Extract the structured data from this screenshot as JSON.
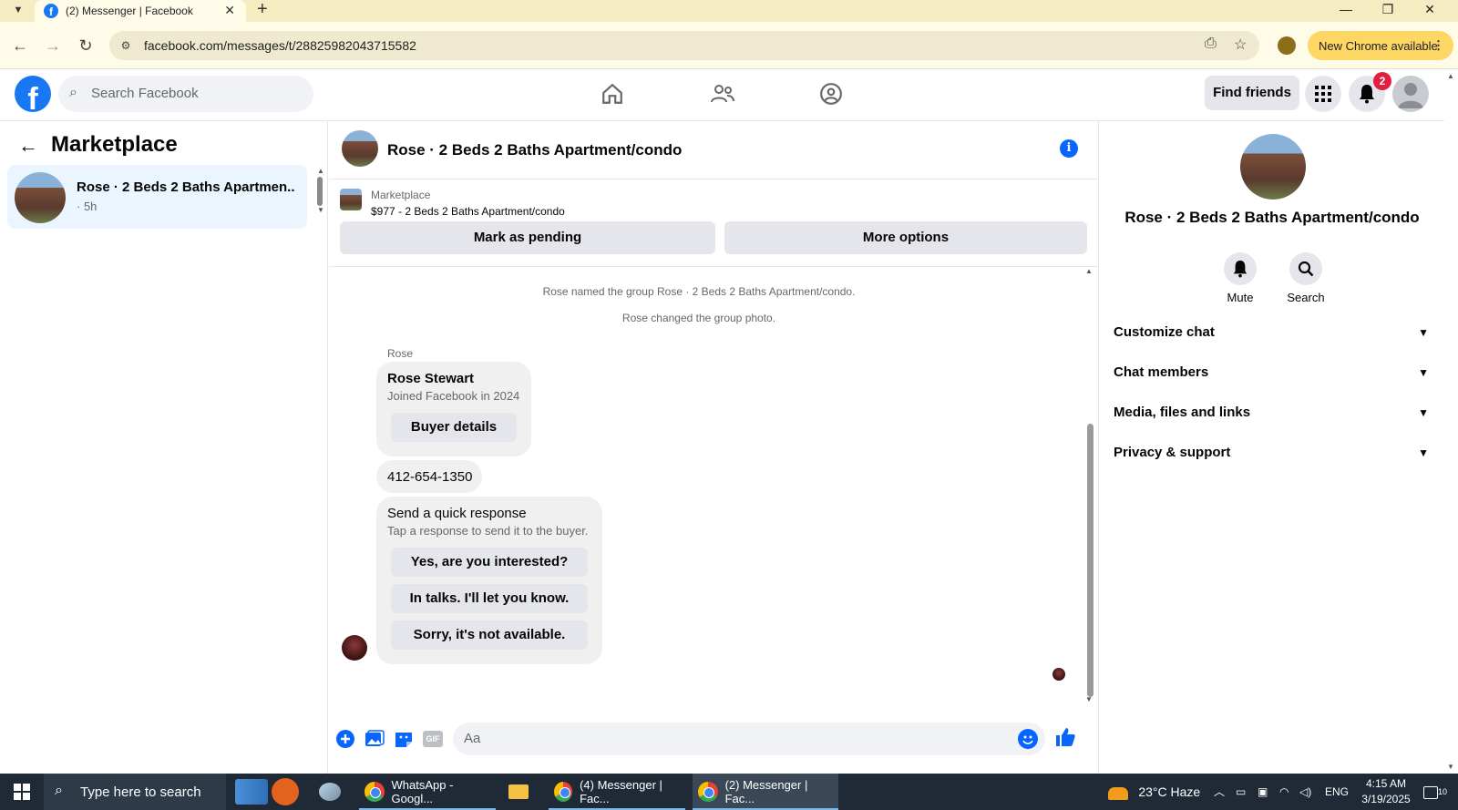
{
  "browser": {
    "tab_title": "(2) Messenger | Facebook",
    "url": "facebook.com/messages/t/28825982043715582",
    "new_chrome_label": "New Chrome available"
  },
  "facebook": {
    "search_placeholder": "Search Facebook",
    "find_friends": "Find friends",
    "notification_count": "2",
    "brand_color": "#1877f2"
  },
  "sidebar": {
    "title": "Marketplace",
    "conversations": [
      {
        "name": "Rose · 2 Beds 2 Baths Apartmen...",
        "time": "· 5h"
      }
    ]
  },
  "chat": {
    "title": "Rose · 2 Beds 2 Baths Apartment/condo",
    "listing_source": "Marketplace",
    "listing_price": "$977 - 2 Beds 2 Baths Apartment/condo",
    "mark_pending": "Mark as pending",
    "more_options": "More options",
    "system_messages": [
      "Rose named the group Rose · 2 Beds 2 Baths Apartment/condo.",
      "Rose changed the group photo."
    ],
    "sender": "Rose",
    "buyer_card": {
      "name": "Rose Stewart",
      "joined": "Joined Facebook in 2024",
      "button": "Buyer details"
    },
    "phone": "412-654-1350",
    "quick_response": {
      "title": "Send a quick response",
      "subtitle": "Tap a response to send it to the buyer.",
      "options": [
        "Yes, are you interested?",
        "In talks. I'll let you know.",
        "Sorry, it's not available."
      ]
    },
    "composer_placeholder": "Aa"
  },
  "details_panel": {
    "title": "Rose · 2 Beds 2 Baths Apartment/condo",
    "actions": [
      "Mute",
      "Search"
    ],
    "sections": [
      "Customize chat",
      "Chat members",
      "Media, files and links",
      "Privacy & support"
    ]
  },
  "taskbar": {
    "search_placeholder": "Type here to search",
    "apps": [
      "WhatsApp - Googl...",
      "(4) Messenger | Fac...",
      "(2) Messenger | Fac..."
    ],
    "weather": "23°C  Haze",
    "language": "ENG",
    "time": "4:15 AM",
    "date": "3/19/2025",
    "notifications": "10"
  }
}
